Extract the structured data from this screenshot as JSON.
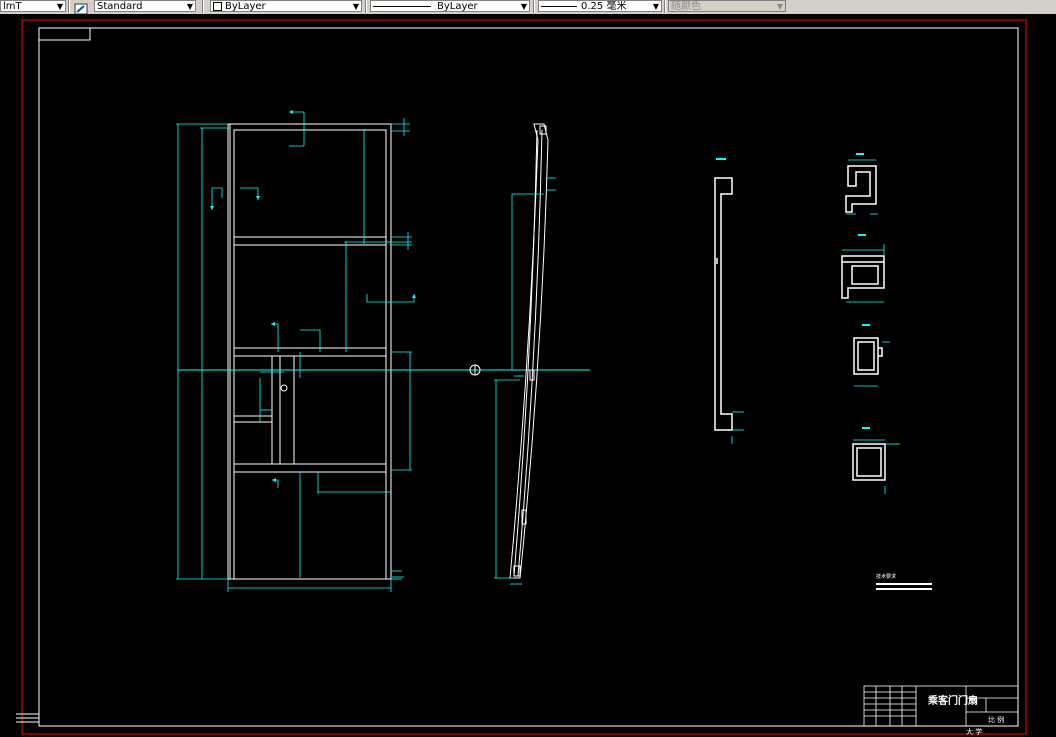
{
  "toolbar": {
    "textstyle_partial": "lmT",
    "textstyle": "Standard",
    "layer": "ByLayer",
    "linetype": "ByLayer",
    "lineweight": "0.25 毫米",
    "plotstyle": "随颜色"
  },
  "drawing": {
    "title_text": "乘客门门扇",
    "title_school": "大 学",
    "title_scale_label": "比 例",
    "section_labels": [
      "A-A",
      "B-B",
      "C-C",
      "D-D"
    ],
    "notes_heading": "技术要求"
  },
  "colors": {
    "background": "#000000",
    "geometry": "#ffffff",
    "dimension": "#00ffff",
    "border": "#ff0000",
    "toolbar": "#d4d0c8"
  }
}
